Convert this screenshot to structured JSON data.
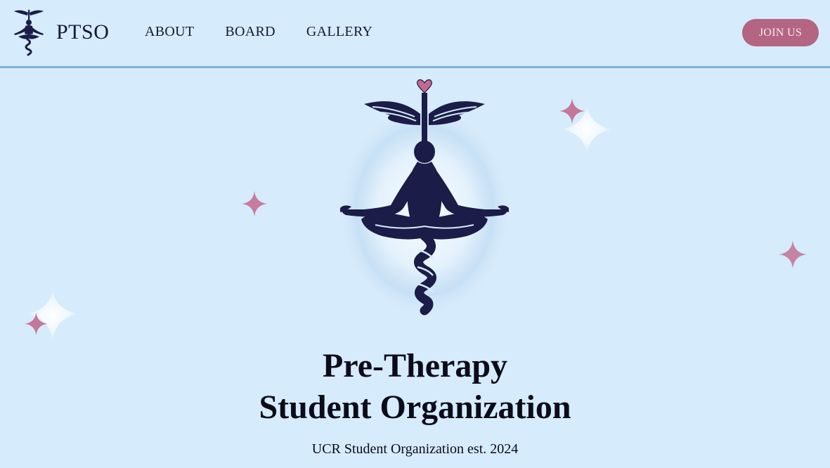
{
  "header": {
    "brand": "PTSO",
    "nav": [
      "ABOUT",
      "BOARD",
      "GALLERY"
    ],
    "join_label": "JOIN US"
  },
  "hero": {
    "title_line1": "Pre-Therapy",
    "title_line2": "Student Organization",
    "subtitle": "UCR Student Organization est. 2024"
  },
  "colors": {
    "background": "#d6ebfb",
    "navy": "#1b1c48",
    "accent_pink": "#b36582",
    "divider": "#7fb0d8"
  },
  "icons": [
    "caduceus-meditation-logo",
    "heart-icon",
    "sparkle-icon"
  ]
}
